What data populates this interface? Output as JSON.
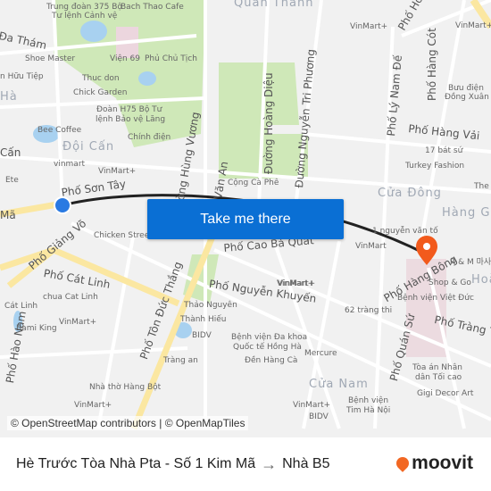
{
  "map": {
    "colors": {
      "background": "#f1f1f1",
      "road": "#ffffff",
      "major_road": "#fbe7a1",
      "park": "#cfe8b8",
      "water": "#a8d1f0",
      "route": "#222222",
      "button": "#0a6fd4",
      "destination_pin": "#f25a1c",
      "origin_dot": "#2a7ae2"
    },
    "labels": [
      "Trung đoàn 375 Bộ",
      "Tư lệnh Cảnh vệ",
      "Bach Thao Cafe",
      "Quán Thánh",
      "Đa Thám",
      "Shoe Master",
      "Viện 69",
      "Phủ Chủ Tịch",
      "n Hữu Tiệp",
      "Thuc don",
      "Chick Garden",
      "Hà",
      "Đoàn H75 Bộ Tư",
      "lệnh Bảo vệ Lăng",
      "Bee Coffee",
      "Chính điện",
      "Đội Cấn",
      "Cấn",
      "vinmart",
      "VinMart+",
      "Ete",
      "Phố Sơn Tây",
      "Mã",
      "Đường Hùng Vương",
      "Văn An",
      "Cộng Cà Phê",
      "Đường Hoàng Diệu",
      "Đường Nguyễn Tri Phương",
      "VinMart+",
      "Phố Hoè",
      "VinMart+",
      "Phố Lý Nam Đế",
      "Phố Hàng Cót",
      "Bưu điện",
      "Đồng Xuân",
      "Phố Hàng Vải",
      "17 bát sứ",
      "Turkey Fashion",
      "Cửa Đông",
      "The Cafe",
      "Hàng Ga",
      "Phố Giảng Võ",
      "Chicken Street",
      "Phố Cát Linh",
      "chua Cat Linh",
      "Cát Linh",
      "Bami King",
      "VinMart+",
      "Phố Hào Nam",
      "Phố Tôn Đức Thắng",
      "Thảo Nguyên",
      "Thành Hiếu",
      "BIDV",
      "Tràng an",
      "Nhà thờ Hàng Bột",
      "VinMart+",
      "Phố Cao Bá Quát",
      "Phố Nguyễn Khuyến",
      "VinMart+",
      "1 nguyễn văn tố",
      "VinMart",
      "Phố Hàng Bông",
      "R & M 마사지",
      "Shop & Go",
      "Hoà",
      "Bệnh viện Việt Đức",
      "62 tràng thi",
      "Phố Tràng Thi",
      "VinMart+",
      "Bệnh viện Đa khoa",
      "Quốc tế Hồng Hà",
      "Đền Hàng Cà",
      "Mercure",
      "Phố Quán Sứ",
      "Tòa án Nhân",
      "dân Tối cao",
      "Gigi Decor Art",
      "Cửa Nam",
      "Bệnh viện",
      "Tim Hà Nội",
      "BIDV",
      "VinMart+"
    ],
    "take_me_there": "Take me there",
    "attribution": "© OpenStreetMap contributors | © OpenMapTiles"
  },
  "footer": {
    "origin": "Hè Trước Tòa Nhà Pta - Số 1 Kim Mã",
    "arrow": "→",
    "destination": "Nhà B5",
    "logo": "moovit"
  }
}
